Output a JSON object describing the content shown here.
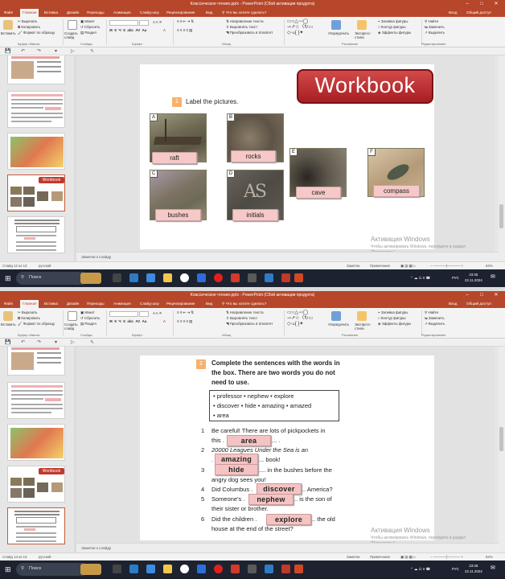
{
  "window": {
    "title": "Классическое чтение.pptx - PowerPoint (Сбой активации продукта)",
    "minimize": "–",
    "restore": "□",
    "close": "✕"
  },
  "menu_tabs": [
    "Файл",
    "Главная",
    "Вставка",
    "Дизайн",
    "Переходы",
    "Анимация",
    "Слайд-шоу",
    "Рецензирование",
    "Вид"
  ],
  "tell_me": "Что вы хотите сделать?",
  "account": {
    "signin": "Вход",
    "share": "Общий доступ"
  },
  "ribbon": {
    "paste": "Вставить",
    "cut": "Вырезать",
    "copy": "Копировать",
    "format_painter": "Формат по образцу",
    "clipboard_group": "Буфер обмена",
    "new_slide": "Создать слайд",
    "layout": "Макет",
    "reset": "Сбросить",
    "section": "Раздел",
    "slides_group": "Слайды",
    "font_group": "Шрифт",
    "paragraph_group": "Абзац",
    "text_direction": "Направление текста",
    "align_text": "Выровнять текст",
    "smartart": "Преобразовать в SmartArt",
    "arrange": "Упорядочить",
    "quick_styles": "Экспресс-стили",
    "shape_fill": "Заливка фигуры",
    "shape_outline": "Контур фигуры",
    "shape_effects": "Эффекты фигуры",
    "drawing_group": "Рисование",
    "find": "Найти",
    "replace": "Заменить",
    "select": "Выделить",
    "editing_group": "Редактирование"
  },
  "thumbnails_top": [
    {
      "num": "10"
    },
    {
      "num": "11"
    },
    {
      "num": "12",
      "banner": "Workbook"
    },
    {
      "num": "13"
    }
  ],
  "thumbnails_bottom": [
    {
      "num": "10"
    },
    {
      "num": "11"
    },
    {
      "num": "12",
      "banner": "Workbook"
    },
    {
      "num": "13"
    }
  ],
  "notes_label": "Заметки к слайду",
  "status_top": {
    "slide": "Слайд 12 из 13",
    "lang": "русский",
    "notes": "Заметки",
    "comments": "Примечания",
    "zoom": "94%"
  },
  "status_bottom": {
    "slide": "Слайд 13 из 13",
    "lang": "русский",
    "notes": "Заметки",
    "comments": "Примечания",
    "zoom": "94%"
  },
  "watermark": {
    "title": "Активация Windows",
    "subtitle": "Чтобы активировать Windows, перейдите в раздел",
    "subtitle2": "\"Параметры\"."
  },
  "taskbar_top": {
    "search": "Поиск",
    "lang": "РУС",
    "time": "23:45",
    "date": "22.11.2024"
  },
  "taskbar_bottom": {
    "search": "Поиск",
    "lang": "РУС",
    "time": "23:46",
    "date": "22.11.2024"
  },
  "slide12": {
    "banner": "Workbook",
    "task_number": "1",
    "instruction": "Label the pictures.",
    "pictures": [
      {
        "letter": "A",
        "label": "raft"
      },
      {
        "letter": "B",
        "label": "rocks"
      },
      {
        "letter": "C",
        "label": "bushes"
      },
      {
        "letter": "D",
        "label": "initials"
      },
      {
        "letter": "E",
        "label": "cave"
      },
      {
        "letter": "F",
        "label": "compass"
      }
    ]
  },
  "slide13": {
    "task_number": "2",
    "instruction_l1": "Complete the sentences with the words in",
    "instruction_l2": "the box. There are two words you do not",
    "instruction_l3": "need to use.",
    "box_row1": "• professor  • nephew  • explore",
    "box_row2": "• discover  • hide  • amazing  • amazed",
    "box_row3": "• area",
    "sentences": [
      {
        "n": "1",
        "l1": "Be careful! There are lots of pickpockets in",
        "pre": "this .",
        "answer": "area",
        "post": "... ."
      },
      {
        "n": "2",
        "l1": "20000 Leagues Under the Sea is an",
        "pre": ".",
        "answer": "amazing",
        "post": "... book!"
      },
      {
        "n": "3",
        "pre": "",
        "answer": "hide",
        "post": ".... in the bushes before the",
        "l2": "angry dog sees you!"
      },
      {
        "n": "4",
        "pre": "Did Columbus .",
        "answer": "discover",
        "post": ".. America?"
      },
      {
        "n": "5",
        "pre": "Someone's .",
        "answer": "nephew",
        "post": ".. is the son of",
        "l2": "their sister or brother."
      },
      {
        "n": "6",
        "pre": "Did the children .",
        "answer": "explore",
        "post": ".. the old",
        "l2": "house at the end of the street?"
      }
    ]
  }
}
